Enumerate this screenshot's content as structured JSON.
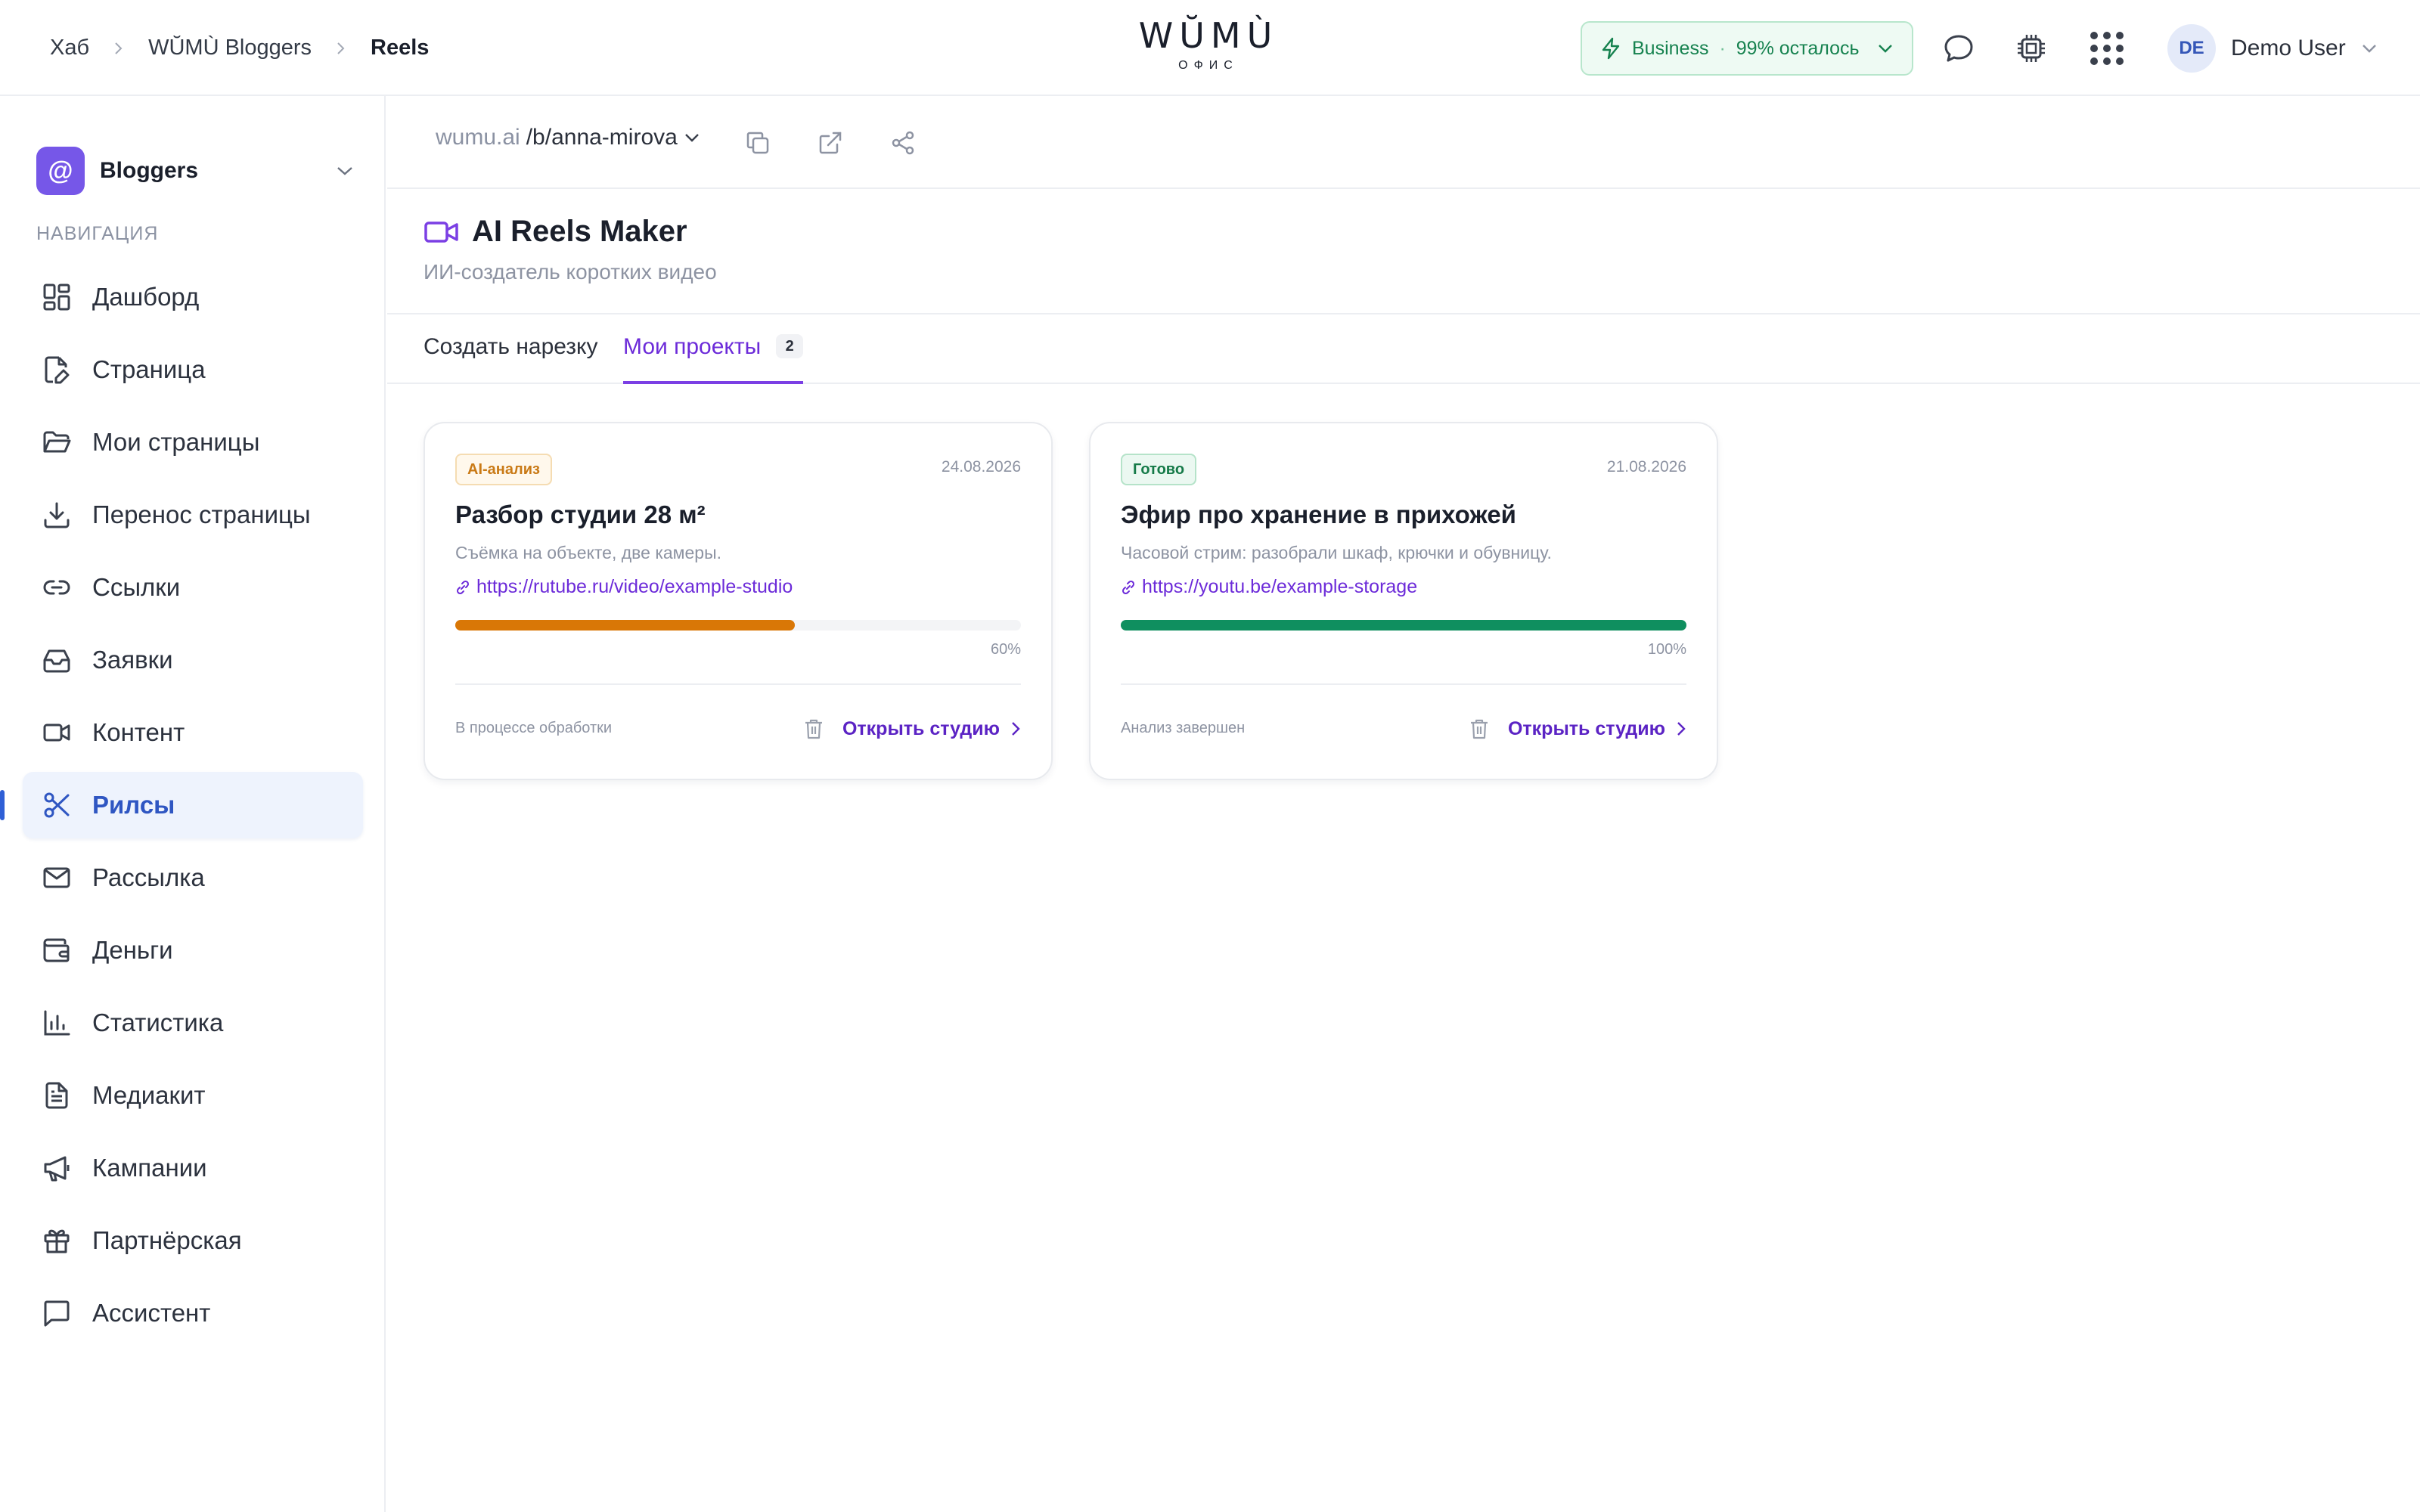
{
  "header": {
    "breadcrumbs": [
      "Хаб",
      "WŬMÙ Bloggers",
      "Reels"
    ],
    "logo": {
      "wordmark": "WŬMÙ",
      "sub": "ОФИС"
    },
    "plan": {
      "name": "Business",
      "remaining": "99% осталось"
    },
    "user": {
      "initials": "DE",
      "name": "Demo User"
    }
  },
  "sidebar": {
    "workspace": "Bloggers",
    "nav_heading": "НАВИГАЦИЯ",
    "items": [
      {
        "label": "Дашборд",
        "icon": "dashboard-icon"
      },
      {
        "label": "Страница",
        "icon": "page-edit-icon"
      },
      {
        "label": "Мои страницы",
        "icon": "folder-icon"
      },
      {
        "label": "Перенос страницы",
        "icon": "download-icon"
      },
      {
        "label": "Ссылки",
        "icon": "link-icon"
      },
      {
        "label": "Заявки",
        "icon": "inbox-icon"
      },
      {
        "label": "Контент",
        "icon": "video-icon"
      },
      {
        "label": "Рилсы",
        "icon": "scissors-icon",
        "active": true
      },
      {
        "label": "Рассылка",
        "icon": "mail-icon"
      },
      {
        "label": "Деньги",
        "icon": "wallet-icon"
      },
      {
        "label": "Статистика",
        "icon": "bar-chart-icon"
      },
      {
        "label": "Медиакит",
        "icon": "document-icon"
      },
      {
        "label": "Кампании",
        "icon": "megaphone-icon"
      },
      {
        "label": "Партнёрская",
        "icon": "gift-icon"
      },
      {
        "label": "Ассистент",
        "icon": "chat-icon"
      }
    ]
  },
  "url": {
    "host": "wumu.ai",
    "path": "/b/anna-mirova"
  },
  "page": {
    "title": "AI Reels Maker",
    "subtitle": "ИИ-создатель коротких видео"
  },
  "tabs": {
    "create": "Создать нарезку",
    "projects": "Мои проекты",
    "projects_count": "2"
  },
  "projects": [
    {
      "status": "AI-анализ",
      "date": "24.08.2026",
      "title": "Разбор студии 28 м²",
      "description": "Съёмка на объекте, две камеры.",
      "link": "https://rutube.ru/video/example-studio",
      "progress": 0.6,
      "progress_label": "60%",
      "progress_color": "#d97706",
      "state": "В процессе обработки",
      "open": "Открыть студию"
    },
    {
      "status": "Готово",
      "date": "21.08.2026",
      "title": "Эфир про хранение в прихожей",
      "description": "Часовой стрим: разобрали шкаф, крючки и обувницу.",
      "link": "https://youtu.be/example-storage",
      "progress": 1.0,
      "progress_label": "100%",
      "progress_color": "#0f8f5f",
      "state": "Анализ завершен",
      "open": "Открыть студию"
    }
  ],
  "colors": {
    "accent": "#6c2bd9",
    "nav_active": "#2f56c2"
  }
}
